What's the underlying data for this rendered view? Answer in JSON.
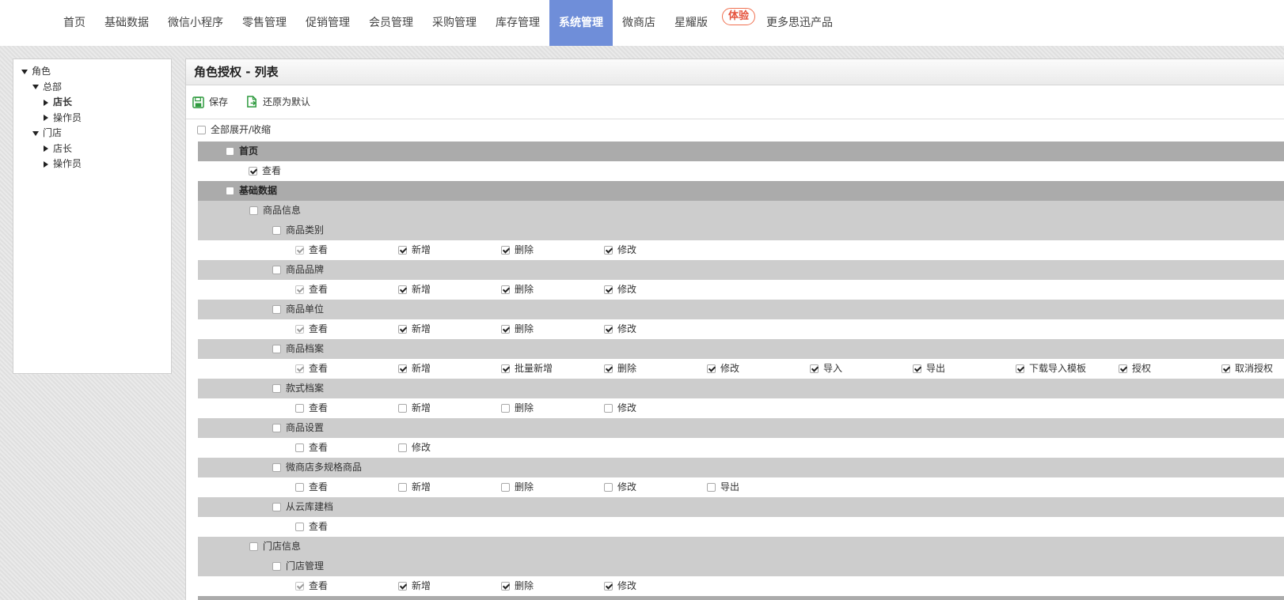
{
  "nav": {
    "items": [
      {
        "label": "首页",
        "active": false
      },
      {
        "label": "基础数据",
        "active": false
      },
      {
        "label": "微信小程序",
        "active": false
      },
      {
        "label": "零售管理",
        "active": false
      },
      {
        "label": "促销管理",
        "active": false
      },
      {
        "label": "会员管理",
        "active": false
      },
      {
        "label": "采购管理",
        "active": false
      },
      {
        "label": "库存管理",
        "active": false
      },
      {
        "label": "系统管理",
        "active": true
      },
      {
        "label": "微商店",
        "active": false
      },
      {
        "label": "星耀版",
        "active": false,
        "badge": "体验"
      },
      {
        "label": "更多思迅产品",
        "active": false
      }
    ],
    "active_color": "#6f8ed9"
  },
  "tree": {
    "nodes": [
      {
        "label": "角色",
        "level": 0,
        "expanded": true,
        "selected": false
      },
      {
        "label": "总部",
        "level": 1,
        "expanded": true,
        "selected": false
      },
      {
        "label": "店长",
        "level": 2,
        "expanded": false,
        "selected": true
      },
      {
        "label": "操作员",
        "level": 2,
        "expanded": false,
        "selected": false
      },
      {
        "label": "门店",
        "level": 1,
        "expanded": true,
        "selected": false
      },
      {
        "label": "店长",
        "level": 2,
        "expanded": false,
        "selected": false
      },
      {
        "label": "操作员",
        "level": 2,
        "expanded": false,
        "selected": false
      }
    ]
  },
  "panel": {
    "title": "角色授权 - 列表",
    "save_label": "保存",
    "restore_label": "还原为默认",
    "toggle_all_label": "全部展开/收缩"
  },
  "permissions": [
    {
      "type": "group",
      "level": 1,
      "label": "首页",
      "checked": false
    },
    {
      "type": "perms",
      "level": 1,
      "items": [
        {
          "label": "查看",
          "checked": true,
          "disabled": false
        }
      ]
    },
    {
      "type": "group",
      "level": 1,
      "label": "基础数据",
      "checked": false
    },
    {
      "type": "group",
      "level": 2,
      "label": "商品信息",
      "checked": false
    },
    {
      "type": "group",
      "level": 3,
      "label": "商品类别",
      "checked": false
    },
    {
      "type": "perms",
      "level": 3,
      "items": [
        {
          "label": "查看",
          "checked": true,
          "disabled": true
        },
        {
          "label": "新增",
          "checked": true
        },
        {
          "label": "删除",
          "checked": true
        },
        {
          "label": "修改",
          "checked": true
        }
      ]
    },
    {
      "type": "group",
      "level": 3,
      "label": "商品品牌",
      "checked": false
    },
    {
      "type": "perms",
      "level": 3,
      "items": [
        {
          "label": "查看",
          "checked": true,
          "disabled": true
        },
        {
          "label": "新增",
          "checked": true
        },
        {
          "label": "删除",
          "checked": true
        },
        {
          "label": "修改",
          "checked": true
        }
      ]
    },
    {
      "type": "group",
      "level": 3,
      "label": "商品单位",
      "checked": false
    },
    {
      "type": "perms",
      "level": 3,
      "items": [
        {
          "label": "查看",
          "checked": true,
          "disabled": true
        },
        {
          "label": "新增",
          "checked": true
        },
        {
          "label": "删除",
          "checked": true
        },
        {
          "label": "修改",
          "checked": true
        }
      ]
    },
    {
      "type": "group",
      "level": 3,
      "label": "商品档案",
      "checked": false
    },
    {
      "type": "perms",
      "level": 3,
      "items": [
        {
          "label": "查看",
          "checked": true,
          "disabled": true
        },
        {
          "label": "新增",
          "checked": true
        },
        {
          "label": "批量新增",
          "checked": true
        },
        {
          "label": "删除",
          "checked": true
        },
        {
          "label": "修改",
          "checked": true
        },
        {
          "label": "导入",
          "checked": true
        },
        {
          "label": "导出",
          "checked": true
        },
        {
          "label": "下载导入模板",
          "checked": true
        },
        {
          "label": "授权",
          "checked": true
        },
        {
          "label": "取消授权",
          "checked": true
        }
      ]
    },
    {
      "type": "group",
      "level": 3,
      "label": "款式档案",
      "checked": false
    },
    {
      "type": "perms",
      "level": 3,
      "items": [
        {
          "label": "查看",
          "checked": false
        },
        {
          "label": "新增",
          "checked": false
        },
        {
          "label": "删除",
          "checked": false
        },
        {
          "label": "修改",
          "checked": false
        }
      ]
    },
    {
      "type": "group",
      "level": 3,
      "label": "商品设置",
      "checked": false
    },
    {
      "type": "perms",
      "level": 3,
      "items": [
        {
          "label": "查看",
          "checked": false
        },
        {
          "label": "修改",
          "checked": false
        }
      ]
    },
    {
      "type": "group",
      "level": 3,
      "label": "微商店多规格商品",
      "checked": false
    },
    {
      "type": "perms",
      "level": 3,
      "items": [
        {
          "label": "查看",
          "checked": false
        },
        {
          "label": "新增",
          "checked": false
        },
        {
          "label": "删除",
          "checked": false
        },
        {
          "label": "修改",
          "checked": false
        },
        {
          "label": "导出",
          "checked": false
        }
      ]
    },
    {
      "type": "group",
      "level": 3,
      "label": "从云库建档",
      "checked": false
    },
    {
      "type": "perms",
      "level": 3,
      "items": [
        {
          "label": "查看",
          "checked": false
        }
      ]
    },
    {
      "type": "group",
      "level": 2,
      "label": "门店信息",
      "checked": false
    },
    {
      "type": "group",
      "level": 3,
      "label": "门店管理",
      "checked": false
    },
    {
      "type": "perms",
      "level": 3,
      "items": [
        {
          "label": "查看",
          "checked": true,
          "disabled": true
        },
        {
          "label": "新增",
          "checked": true
        },
        {
          "label": "删除",
          "checked": true
        },
        {
          "label": "修改",
          "checked": true
        }
      ]
    },
    {
      "type": "group",
      "level": 1,
      "label": "",
      "checked": false
    }
  ]
}
